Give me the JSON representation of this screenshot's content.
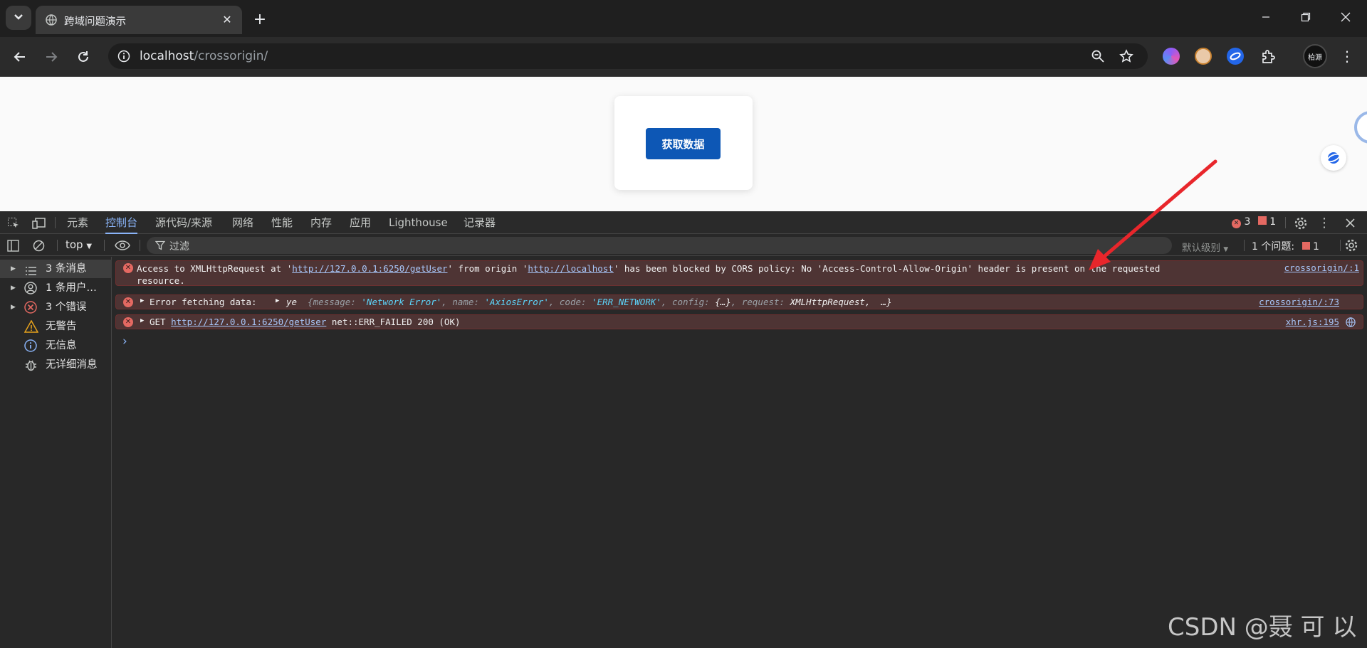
{
  "browser": {
    "tab_title": "跨域问题演示",
    "url_host": "localhost",
    "url_path": "/crossorigin/",
    "profile_label": "柏源"
  },
  "page": {
    "fetch_button_label": "获取数据"
  },
  "devtools": {
    "tabs": [
      "元素",
      "控制台",
      "源代码/来源",
      "网络",
      "性能",
      "内存",
      "应用",
      "Lighthouse",
      "记录器"
    ],
    "active_tab": "控制台",
    "error_count": "3",
    "issue_badge_count": "1",
    "context": "top",
    "filter_placeholder": "过滤",
    "level_select": "默认级别",
    "issues_label": "1 个问题:",
    "issues_count": "1",
    "sidebar": [
      {
        "label": "3 条消息",
        "icon": "list-icon"
      },
      {
        "label": "1 条用户…",
        "icon": "user-icon"
      },
      {
        "label": "3 个错误",
        "icon": "error-icon"
      },
      {
        "label": "无警告",
        "icon": "warning-icon"
      },
      {
        "label": "无信息",
        "icon": "info-icon"
      },
      {
        "label": "无详细消息",
        "icon": "bug-icon"
      }
    ],
    "messages": {
      "cors": {
        "text_a": "Access to XMLHttpRequest at '",
        "url1": "http://127.0.0.1:6250/getUser",
        "text_b": "' from origin '",
        "url2": "http://localhost",
        "text_c": "' has been blocked by CORS policy: No 'Access-Control-Allow-Origin' header is present on the requested",
        "text_d": "resource.",
        "source": "crossorigin/:1"
      },
      "fetch": {
        "label": "Error fetching data:",
        "obj_type": "ye",
        "obj_open": "{",
        "k_message": "message:",
        "v_message": "'Network Error'",
        "k_name": "name:",
        "v_name": "'AxiosError'",
        "k_code": "code:",
        "v_code": "'ERR_NETWORK'",
        "k_config": "config:",
        "v_config": "{…}",
        "k_request": "request:",
        "v_request": "XMLHttpRequest,",
        "obj_tail": "…}",
        "source": "crossorigin/:73"
      },
      "get": {
        "method": "GET",
        "url": "http://127.0.0.1:6250/getUser",
        "status": "net::ERR_FAILED 200 (OK)",
        "source": "xhr.js:195"
      }
    },
    "prompt": "›"
  },
  "watermark": "CSDN @聂 可 以",
  "colors": {
    "accent": "#8ab4f8",
    "button": "#0d57b5",
    "error_bg": "#4e3434",
    "error_icon": "#e46962",
    "annotation_arrow": "#e8262b"
  }
}
